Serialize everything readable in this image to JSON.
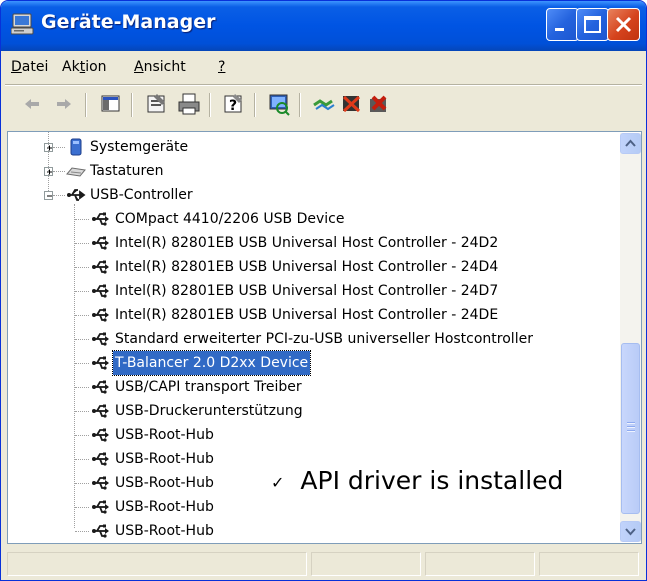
{
  "window": {
    "title": "Geräte-Manager",
    "colors": {
      "titlebar": "#0054e3",
      "selection": "#316ac5",
      "close": "#d5431d"
    }
  },
  "menu": {
    "items": [
      {
        "label": "Datei",
        "mnemonic": "D",
        "rest": "atei"
      },
      {
        "label": "Aktion",
        "pre": "Ak",
        "mnemonic": "t",
        "rest": "ion"
      },
      {
        "label": "Ansicht",
        "mnemonic": "A",
        "rest": "nsicht"
      },
      {
        "label": "?",
        "mnemonic": "?"
      }
    ]
  },
  "toolbar": {
    "buttons": [
      {
        "icon": "back-arrow-icon"
      },
      {
        "icon": "forward-arrow-icon"
      },
      {
        "icon": "show-hide-console-tree-icon"
      },
      {
        "icon": "properties-icon"
      },
      {
        "icon": "print-icon"
      },
      {
        "icon": "help-icon"
      },
      {
        "icon": "scan-hardware-icon"
      },
      {
        "icon": "update-driver-icon"
      },
      {
        "icon": "disable-device-icon"
      },
      {
        "icon": "uninstall-device-icon"
      }
    ]
  },
  "tree": {
    "categories": [
      {
        "label": "Systemgeräte",
        "expanded": false,
        "icon": "system-devices-icon"
      },
      {
        "label": "Tastaturen",
        "expanded": false,
        "icon": "keyboard-icon"
      },
      {
        "label": "USB-Controller",
        "expanded": true,
        "icon": "usb-icon"
      }
    ],
    "usb_devices": [
      "COMpact 4410/2206 USB Device",
      "Intel(R) 82801EB USB Universal Host Controller - 24D2",
      "Intel(R) 82801EB USB Universal Host Controller - 24D4",
      "Intel(R) 82801EB USB Universal Host Controller - 24D7",
      "Intel(R) 82801EB USB Universal Host Controller - 24DE",
      "Standard erweiterter PCI-zu-USB universeller Hostcontroller",
      "T-Balancer 2.0 D2xx Device",
      "USB/CAPI transport Treiber",
      "USB-Druckerunterstützung",
      "USB-Root-Hub",
      "USB-Root-Hub",
      "USB-Root-Hub",
      "USB-Root-Hub",
      "USB-Root-Hub"
    ],
    "selected": "T-Balancer 2.0 D2xx Device"
  },
  "annotation": {
    "checkmark": "✓",
    "text": "API driver is installed"
  }
}
